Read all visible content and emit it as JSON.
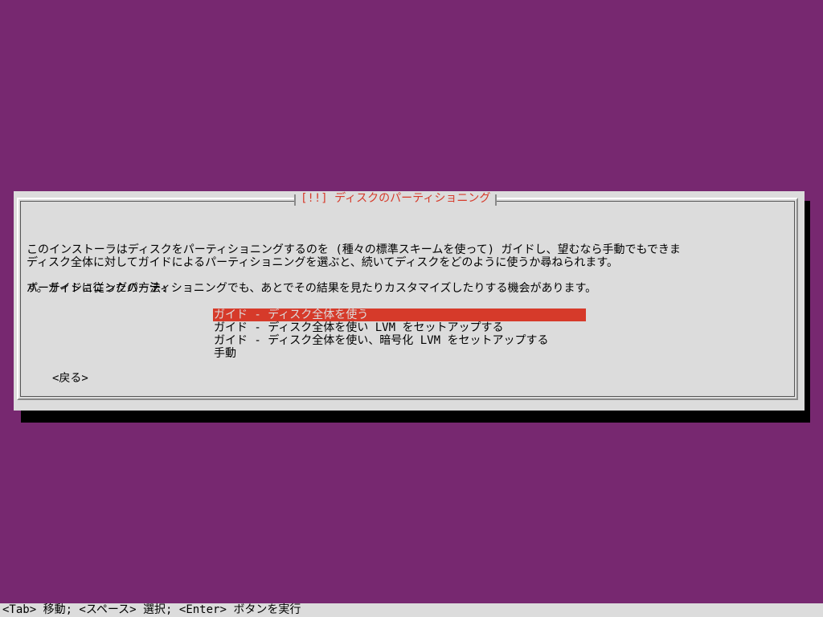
{
  "dialog": {
    "title": "[!!] ディスクのパーティショニング",
    "paragraph1_line1": "このインストーラはディスクをパーティショニングするのを (種々の標準スキームを使って) ガイドし、望むなら手動でもできま",
    "paragraph1_line2": "す。ガイドに従ったパーティショニングでも、あとでその結果を見たりカスタマイズしたりする機会があります。",
    "paragraph2": "ディスク全体に対してガイドによるパーティショニングを選ぶと、続いてディスクをどのように使うか尋ねられます。",
    "method_label": "パーティショニングの方法:",
    "options": [
      "ガイド - ディスク全体を使う",
      "ガイド - ディスク全体を使い LVM をセットアップする",
      "ガイド - ディスク全体を使い、暗号化 LVM をセットアップする",
      "手動"
    ],
    "selected_index": 0,
    "back_label": "<戻る>"
  },
  "statusbar": {
    "text": "<Tab> 移動; <スペース> 選択; <Enter> ボタンを実行"
  },
  "colors": {
    "background": "#772870",
    "dialog": "#dcdcdc",
    "accent": "#d63a2a"
  }
}
